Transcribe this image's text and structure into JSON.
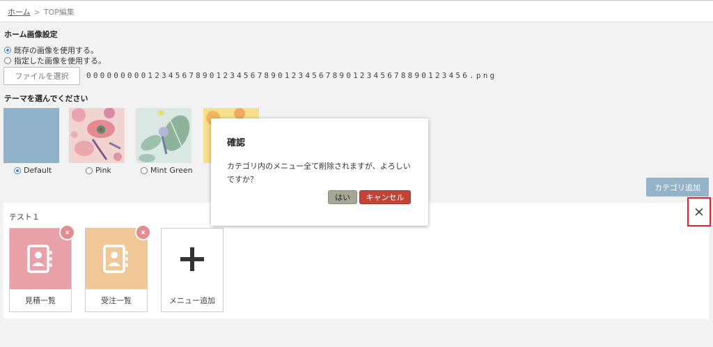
{
  "breadcrumb": {
    "home": "ホーム",
    "separator": ">",
    "current": "TOP編集"
  },
  "home_image": {
    "title": "ホーム画像設定",
    "options": [
      {
        "label": "既存の画像を使用する。",
        "selected": true
      },
      {
        "label": "指定した画像を使用する。",
        "selected": false
      }
    ],
    "file_button": "ファイルを選択",
    "file_name": "00000000012345678901234567890123456789012345678890123456.png"
  },
  "theme": {
    "title": "テーマを選んでください",
    "options": [
      {
        "label": "Default",
        "selected": true,
        "color": "#8fb1c9"
      },
      {
        "label": "Pink",
        "selected": false,
        "color": "#f1d3d0"
      },
      {
        "label": "Mint Green",
        "selected": false,
        "color": "#d9e8e3"
      },
      {
        "label": "",
        "selected": false,
        "color": "#f6e08a"
      }
    ]
  },
  "category_add_button": "カテゴリ追加",
  "category": {
    "name": "テスト１",
    "delete_icon": "×",
    "menus": [
      {
        "label": "見積一覧",
        "color": "#e8a1a8",
        "icon": "contact-book-icon",
        "remove": "x"
      },
      {
        "label": "受注一覧",
        "color": "#f0c898",
        "icon": "contact-book-icon",
        "remove": "x"
      }
    ],
    "add_menu": {
      "label": "メニュー追加",
      "icon": "plus-icon"
    }
  },
  "dialog": {
    "title": "確認",
    "message": "カテゴリ内のメニュー全て削除されますが、よろしいですか？",
    "yes": "はい",
    "cancel": "キャンセル"
  },
  "colors": {
    "accent": "#4a7fc4",
    "highlight_border": "#e8202b",
    "cancel": "#c04438",
    "yes": "#a7a593"
  }
}
